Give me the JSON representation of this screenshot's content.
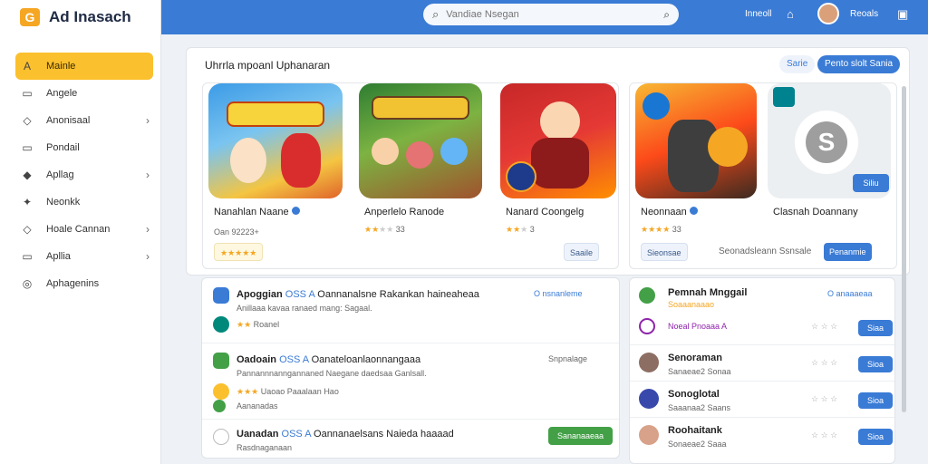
{
  "brand": {
    "name": "Ad Inasach",
    "logo": "G"
  },
  "sidebar": {
    "items": [
      {
        "label": "Mainle",
        "icon": "A",
        "active": true,
        "chevron": ""
      },
      {
        "label": "Angele",
        "icon": "▭",
        "chevron": ""
      },
      {
        "label": "Anonisaal",
        "icon": "◇",
        "chevron": "›"
      },
      {
        "label": "Pondail",
        "icon": "▭",
        "chevron": ""
      },
      {
        "label": "Apllag",
        "icon": "◆",
        "chevron": "›"
      },
      {
        "label": "Neonkk",
        "icon": "✦",
        "chevron": ""
      },
      {
        "label": "Hoale Cannan",
        "icon": "◇",
        "chevron": "›"
      },
      {
        "label": "Apllia",
        "icon": "▭",
        "chevron": "›"
      },
      {
        "label": "Aphagenins",
        "icon": "◎",
        "chevron": ""
      }
    ]
  },
  "topbar": {
    "search_placeholder": "Vandiae Nsegan",
    "link": "Inneoll",
    "user": "Reoals"
  },
  "featured": {
    "title": "Uhrrla mpoanl Uphanaran",
    "chip": "Sarie",
    "button": "Pento slolt Sania",
    "cards": [
      {
        "title": "Nanahlan Naane",
        "verified": true,
        "stars": "★★★★★",
        "sub": "Oan 92223+",
        "tag": "Saaile"
      },
      {
        "title": "Anperlelo Ranode",
        "stars": "★★",
        "grey": "★★",
        "count": "33"
      },
      {
        "title": "Nanard Coongelg",
        "stars": "★★",
        "grey": "★",
        "count": "3"
      },
      {
        "title": "Neonnaan",
        "verified": true,
        "stars": "★★★★",
        "count": "33",
        "tag": "Sieonsae"
      },
      {
        "title": "Clasnah Doannany",
        "sub": "Seonadsleann Ssnsale",
        "tag": "Penanmie",
        "badge": "Siliu"
      }
    ]
  },
  "list_left": [
    {
      "title": "Apoggian",
      "code": "OSS A",
      "desc": "Oannanalsne Rakankan haineaheaa",
      "desc2": "Anillaaa kavaa ranaed mang: Sagaal.",
      "meta": "O nsnanleme",
      "stars": "★★",
      "sub": "Roanel"
    },
    {
      "title": "Oadoain",
      "code": "OSS A",
      "desc": "Oanateloanlaonnangaaa",
      "desc2": "Pannannnanngannaned Naegane daedsaa Ganlsall.",
      "meta": "Snpnalage",
      "stars": "★★★",
      "sub": "Uaoao Paaalaan",
      "sub2": "Hao",
      "sub3": "Aananadas"
    },
    {
      "title": "Uanadan",
      "code": "OSS A",
      "desc": "Oannanaelsans Naieda haaaad",
      "desc2": "Rasdnaganaan",
      "button": "Sananaaeaa"
    }
  ],
  "list_right": [
    {
      "title": "Pemnah Mnggail",
      "sub": "Soaaanaaao",
      "link": "O anaaaeaa",
      "pill": ""
    },
    {
      "title": "",
      "sub": "Noeal Pnoaaa A",
      "pill": "Siaa"
    },
    {
      "title": "Senoraman",
      "sub": "Sanaeae2 Sonaa",
      "pill": "Sioa"
    },
    {
      "title": "Sonoglotal",
      "sub": "Saaanaa2 Saans",
      "pill": "Sioa"
    },
    {
      "title": "Roohaitank",
      "sub": "Sonaeae2 Saaa",
      "pill": "Sioa"
    }
  ]
}
